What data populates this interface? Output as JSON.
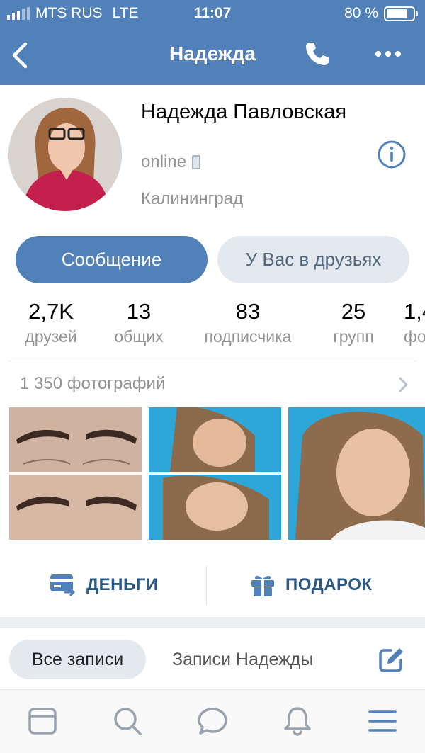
{
  "status_bar": {
    "carrier": "MTS RUS",
    "network": "LTE",
    "time": "11:07",
    "battery": "80 %",
    "battery_level": 0.8
  },
  "nav": {
    "title": "Надежда",
    "icons": [
      "back-chevron-icon",
      "phone-icon",
      "more-dots-icon"
    ]
  },
  "profile": {
    "name": "Надежда Павловская",
    "status": "online",
    "city": "Калининград",
    "icons": [
      "mobile-device-icon",
      "info-icon"
    ]
  },
  "buttons": {
    "message": "Сообщение",
    "friends": "У Вас в друзьях"
  },
  "stats": [
    {
      "value": "2,7K",
      "label": "друзей"
    },
    {
      "value": "13",
      "label": "общих"
    },
    {
      "value": "83",
      "label": "подписчика"
    },
    {
      "value": "25",
      "label": "групп"
    },
    {
      "value": "1,4",
      "label": "фо"
    }
  ],
  "photos": {
    "title": "1 350 фотографий"
  },
  "actions": {
    "money": "ДЕНЬГИ",
    "gift": "ПОДАРОК"
  },
  "wall_tabs": {
    "all": "Все записи",
    "owner": "Записи Надежды"
  },
  "tabbar": {
    "icons": [
      "news-icon",
      "search-icon",
      "messages-icon",
      "notifications-icon",
      "menu-icon"
    ]
  },
  "colors": {
    "header": "#5181b8",
    "accent": "#2a5885",
    "secondary_button": "#e4e9f0",
    "muted_text": "#939393"
  }
}
